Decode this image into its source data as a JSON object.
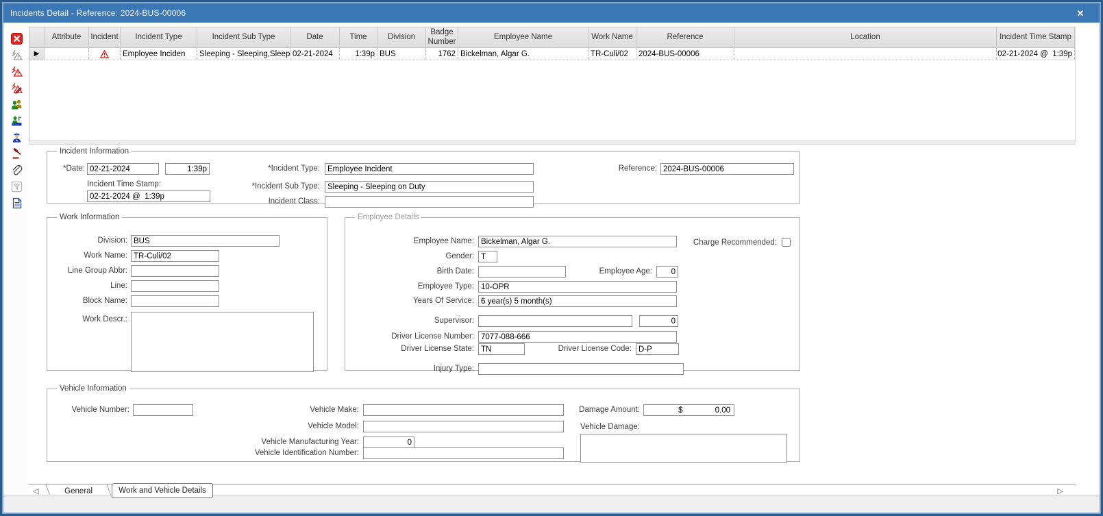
{
  "window": {
    "title": "Incidents Detail - Reference: 2024-BUS-00006",
    "close_glyph": "✕"
  },
  "toolbar": {
    "icons": [
      {
        "name": "close-record-icon"
      },
      {
        "name": "incident-disabled-icon"
      },
      {
        "name": "incident-alert-icon"
      },
      {
        "name": "incident-edit-icon"
      },
      {
        "name": "employees-icon"
      },
      {
        "name": "employee-work-icon"
      },
      {
        "name": "officer-icon"
      },
      {
        "name": "gavel-icon"
      },
      {
        "name": "attachment-icon"
      },
      {
        "name": "filter-disabled-icon"
      },
      {
        "name": "document-icon"
      }
    ]
  },
  "grid": {
    "columns": [
      "Attribute",
      "Incident",
      "Incident Type",
      "Incident Sub Type",
      "Date",
      "Time",
      "Division",
      "Badge Number",
      "Employee Name",
      "Work Name",
      "Reference",
      "Location",
      "Incident Time Stamp"
    ],
    "row": {
      "selector_glyph": "▶",
      "attribute": "",
      "incident_type": "Employee Inciden",
      "incident_sub_type": "Sleeping - Sleeping,Sleep",
      "date": "02-21-2024",
      "time": "1:39p",
      "division": "BUS",
      "badge_number": "1762",
      "employee_name": "Bickelman, Algar G.",
      "work_name": "TR-Culi/02",
      "reference": "2024-BUS-00006",
      "location": "",
      "incident_time_stamp": "02-21-2024 @  1:39p"
    }
  },
  "form": {
    "incident_information": {
      "legend": "Incident Information",
      "date_label": "*Date:",
      "date_value": "02-21-2024",
      "time_value": "1:39p",
      "time_stamp_label": "Incident Time Stamp:",
      "time_stamp_value": "02-21-2024 @  1:39p",
      "incident_type_label": "*Incident Type:",
      "incident_type_value": "Employee Incident",
      "incident_sub_type_label": "*Incident Sub Type:",
      "incident_sub_type_value": "Sleeping - Sleeping on Duty",
      "incident_class_label": "Incident Class:",
      "incident_class_value": "",
      "reference_label": "Reference:",
      "reference_value": "2024-BUS-00006"
    },
    "work_information": {
      "legend": "Work Information",
      "division_label": "Division:",
      "division_value": "BUS",
      "work_name_label": "Work Name:",
      "work_name_value": "TR-Culi/02",
      "line_group_abbr_label": "Line Group Abbr:",
      "line_group_abbr_value": "",
      "line_label": "Line:",
      "line_value": "",
      "block_name_label": "Block Name:",
      "block_name_value": "",
      "work_descr_label": "Work Descr.:",
      "work_descr_value": ""
    },
    "employee_details": {
      "legend": "Employee Details",
      "employee_name_label": "Employee Name:",
      "employee_name_value": "Bickelman, Algar G.",
      "charge_recommended_label": "Charge Recommended:",
      "charge_recommended_checked": false,
      "gender_label": "Gender:",
      "gender_value": "T",
      "birth_date_label": "Birth Date:",
      "birth_date_value": "",
      "employee_age_label": "Employee Age:",
      "employee_age_value": "0",
      "employee_type_label": "Employee Type:",
      "employee_type_value": "10-OPR",
      "years_of_service_label": "Years Of Service:",
      "years_of_service_value": "6 year(s) 5 month(s)",
      "supervisor_label": "Supervisor:",
      "supervisor_value": "",
      "supervisor_number_value": "0",
      "driver_license_number_label": "Driver License Number:",
      "driver_license_number_value": "7077-088-666",
      "driver_license_state_label": "Driver License State:",
      "driver_license_state_value": "TN",
      "driver_license_code_label": "Driver License Code:",
      "driver_license_code_value": "D-P",
      "injury_type_label": "Injury Type:",
      "injury_type_value": ""
    },
    "vehicle_information": {
      "legend": "Vehicle Information",
      "vehicle_number_label": "Vehicle Number:",
      "vehicle_number_value": "",
      "vehicle_make_label": "Vehicle Make:",
      "vehicle_make_value": "",
      "vehicle_model_label": "Vehicle Model:",
      "vehicle_model_value": "",
      "vehicle_manufacturing_year_label": "Vehicle Manufacturing Year:",
      "vehicle_manufacturing_year_value": "0",
      "vehicle_identification_number_label": "Vehicle Identification Number:",
      "vehicle_identification_number_value": "",
      "damage_amount_label": "Damage Amount:",
      "damage_currency": "$",
      "damage_value": "0.00",
      "vehicle_damage_label": "Vehicle Damage:",
      "vehicle_damage_value": ""
    }
  },
  "tabs": {
    "prev_glyph": "◁",
    "next_glyph": "▷",
    "items": [
      {
        "label": "General",
        "active": false
      },
      {
        "label": "Work and Vehicle Details",
        "active": true
      }
    ]
  },
  "colors": {
    "titlebar": "#3b77b4",
    "window_border": "#2a5b8c",
    "warning_red": "#cc0000",
    "header_bg": "#e2e2e2"
  }
}
